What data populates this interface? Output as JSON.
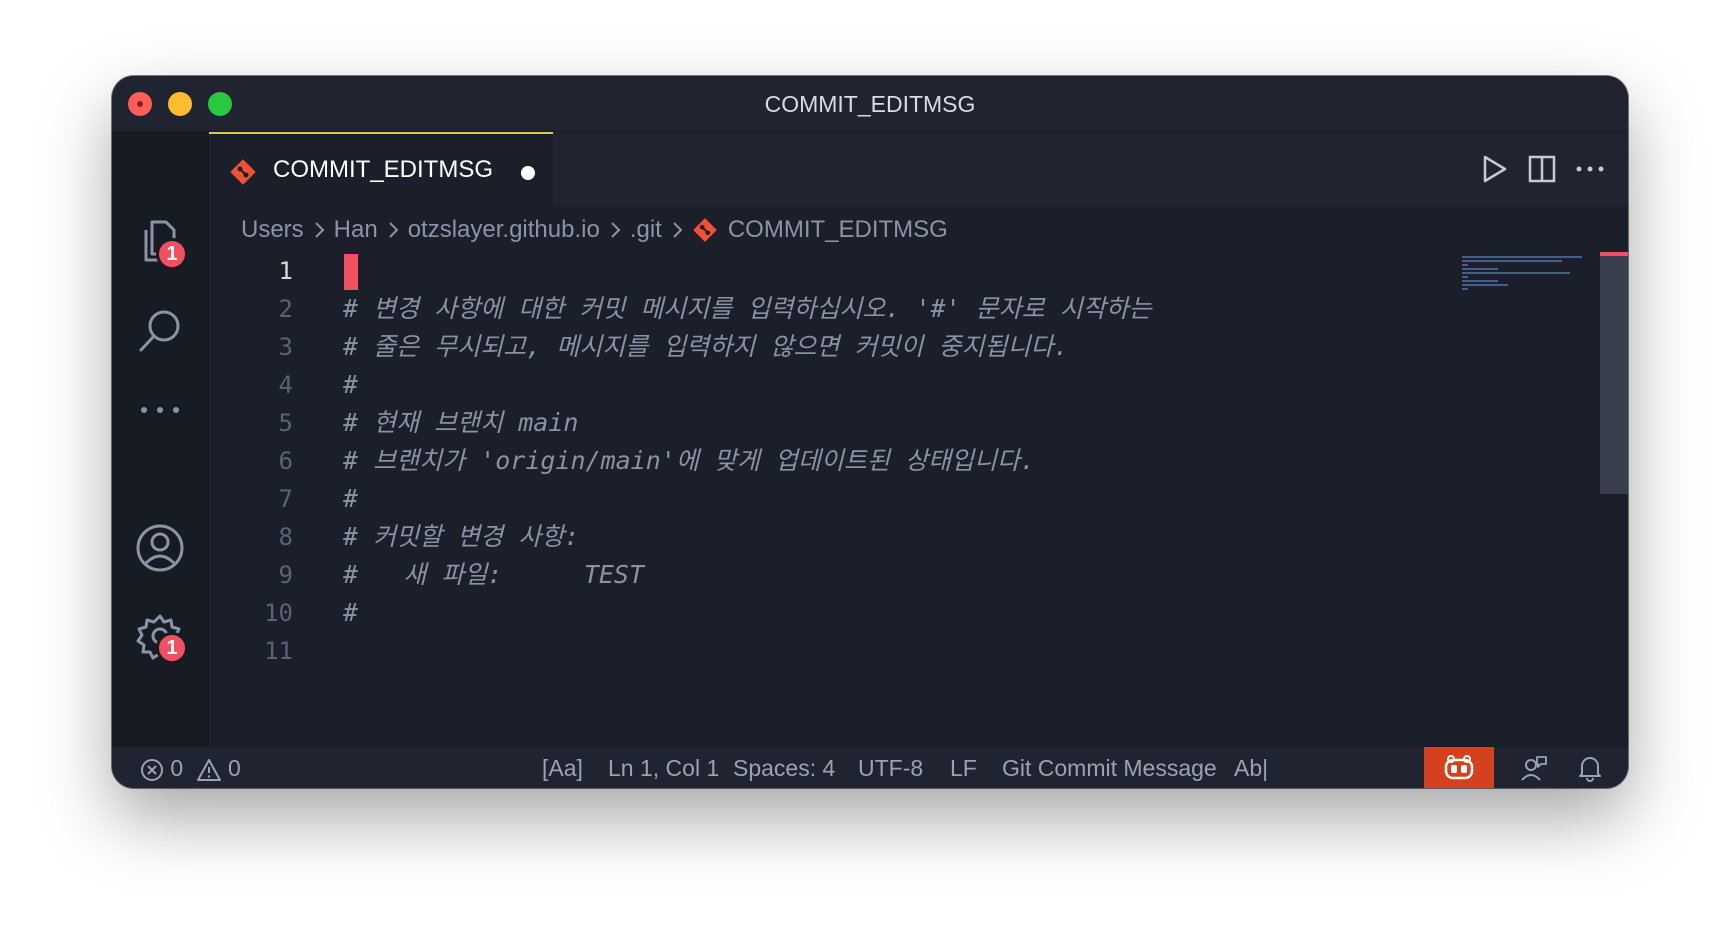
{
  "window": {
    "title": "COMMIT_EDITMSG"
  },
  "activity_bar": {
    "explorer_badge": "1",
    "settings_badge": "1"
  },
  "tab": {
    "label": "COMMIT_EDITMSG"
  },
  "breadcrumb": {
    "items": [
      "Users",
      "Han",
      "otzslayer.github.io",
      ".git"
    ],
    "file": "COMMIT_EDITMSG"
  },
  "editor": {
    "lines": [
      {
        "number": "1",
        "text": ""
      },
      {
        "number": "2",
        "text": "# 변경 사항에 대한 커밋 메시지를 입력하십시오. '#' 문자로 시작하는"
      },
      {
        "number": "3",
        "text": "# 줄은 무시되고, 메시지를 입력하지 않으면 커밋이 중지됩니다."
      },
      {
        "number": "4",
        "text": "#"
      },
      {
        "number": "5",
        "text": "# 현재 브랜치 main"
      },
      {
        "number": "6",
        "text": "# 브랜치가 'origin/main'에 맞게 업데이트된 상태입니다."
      },
      {
        "number": "7",
        "text": "#"
      },
      {
        "number": "8",
        "text": "# 커밋할 변경 사항:"
      },
      {
        "number": "9",
        "text": "#\t새 파일:\t\tTEST"
      },
      {
        "number": "10",
        "text": "#"
      },
      {
        "number": "11",
        "text": ""
      }
    ]
  },
  "status_bar": {
    "errors": "0",
    "warnings": "0",
    "case": "[Aa]",
    "position": "Ln 1, Col 1",
    "spaces": "Spaces: 4",
    "encoding": "UTF-8",
    "eol": "LF",
    "language": "Git Commit Message",
    "spell": "Ab|"
  },
  "colors": {
    "accent_tab": "#e7c547",
    "cursor": "#f0505f",
    "copilot": "#d5401f",
    "git_icon": "#f05033"
  }
}
